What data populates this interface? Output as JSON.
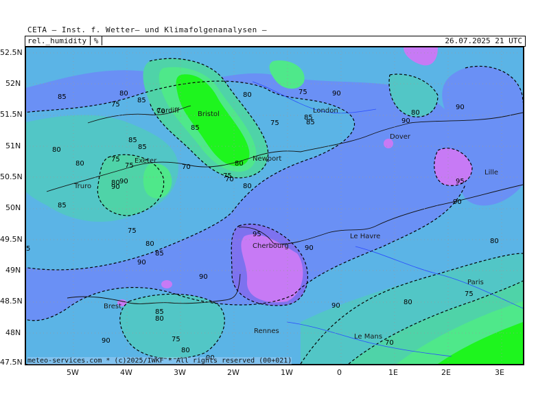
{
  "header": {
    "title": "CETA — Inst. f. Wetter– und Klimafolgenanalysen —",
    "variable": "rel._humidity",
    "unit": "%",
    "valid_time": "26.07.2025  21  UTC"
  },
  "footer": "meteo-services.com * (c)2025/IWKF * All rights reserved (00+021)",
  "axes": {
    "lat_labels": [
      "52.5N",
      "52N",
      "51.5N",
      "51N",
      "50.5N",
      "50N",
      "49.5N",
      "49N",
      "48.5N",
      "48N",
      "47.5N"
    ],
    "lon_labels": [
      "5W",
      "4W",
      "3W",
      "2W",
      "1W",
      "0",
      "1E",
      "2E",
      "3E"
    ]
  },
  "cities": [
    "Truro",
    "Exeter",
    "Cardiff",
    "Bristol",
    "Newport",
    "London",
    "Dover",
    "Le Havre",
    "Cherbourg",
    "Brest",
    "Rennes",
    "Le Mans",
    "Paris",
    "Lille"
  ],
  "contour_labels": [
    "85",
    "80",
    "85",
    "75",
    "75",
    "70",
    "85",
    "85",
    "75",
    "90",
    "80",
    "75",
    "90",
    "80",
    "85",
    "90",
    "85",
    "90",
    "75",
    "80",
    "70",
    "80",
    "90",
    "80",
    "80",
    "90",
    "70",
    "85",
    "95",
    "95",
    "80",
    "75",
    "80",
    "85",
    "90",
    "90",
    "90",
    "90",
    "85",
    "80",
    "80",
    "90",
    "80",
    "75",
    "90",
    "70",
    "75",
    "85",
    "80",
    "75",
    "5"
  ],
  "colors": {
    "h65": "#1ef51e",
    "h70": "#4fe88a",
    "h75": "#4fd3a8",
    "h80": "#52c6c6",
    "h85": "#5bb4e6",
    "h90": "#6a90f5",
    "h95": "#7d72ef",
    "h100": "#c77af5"
  }
}
